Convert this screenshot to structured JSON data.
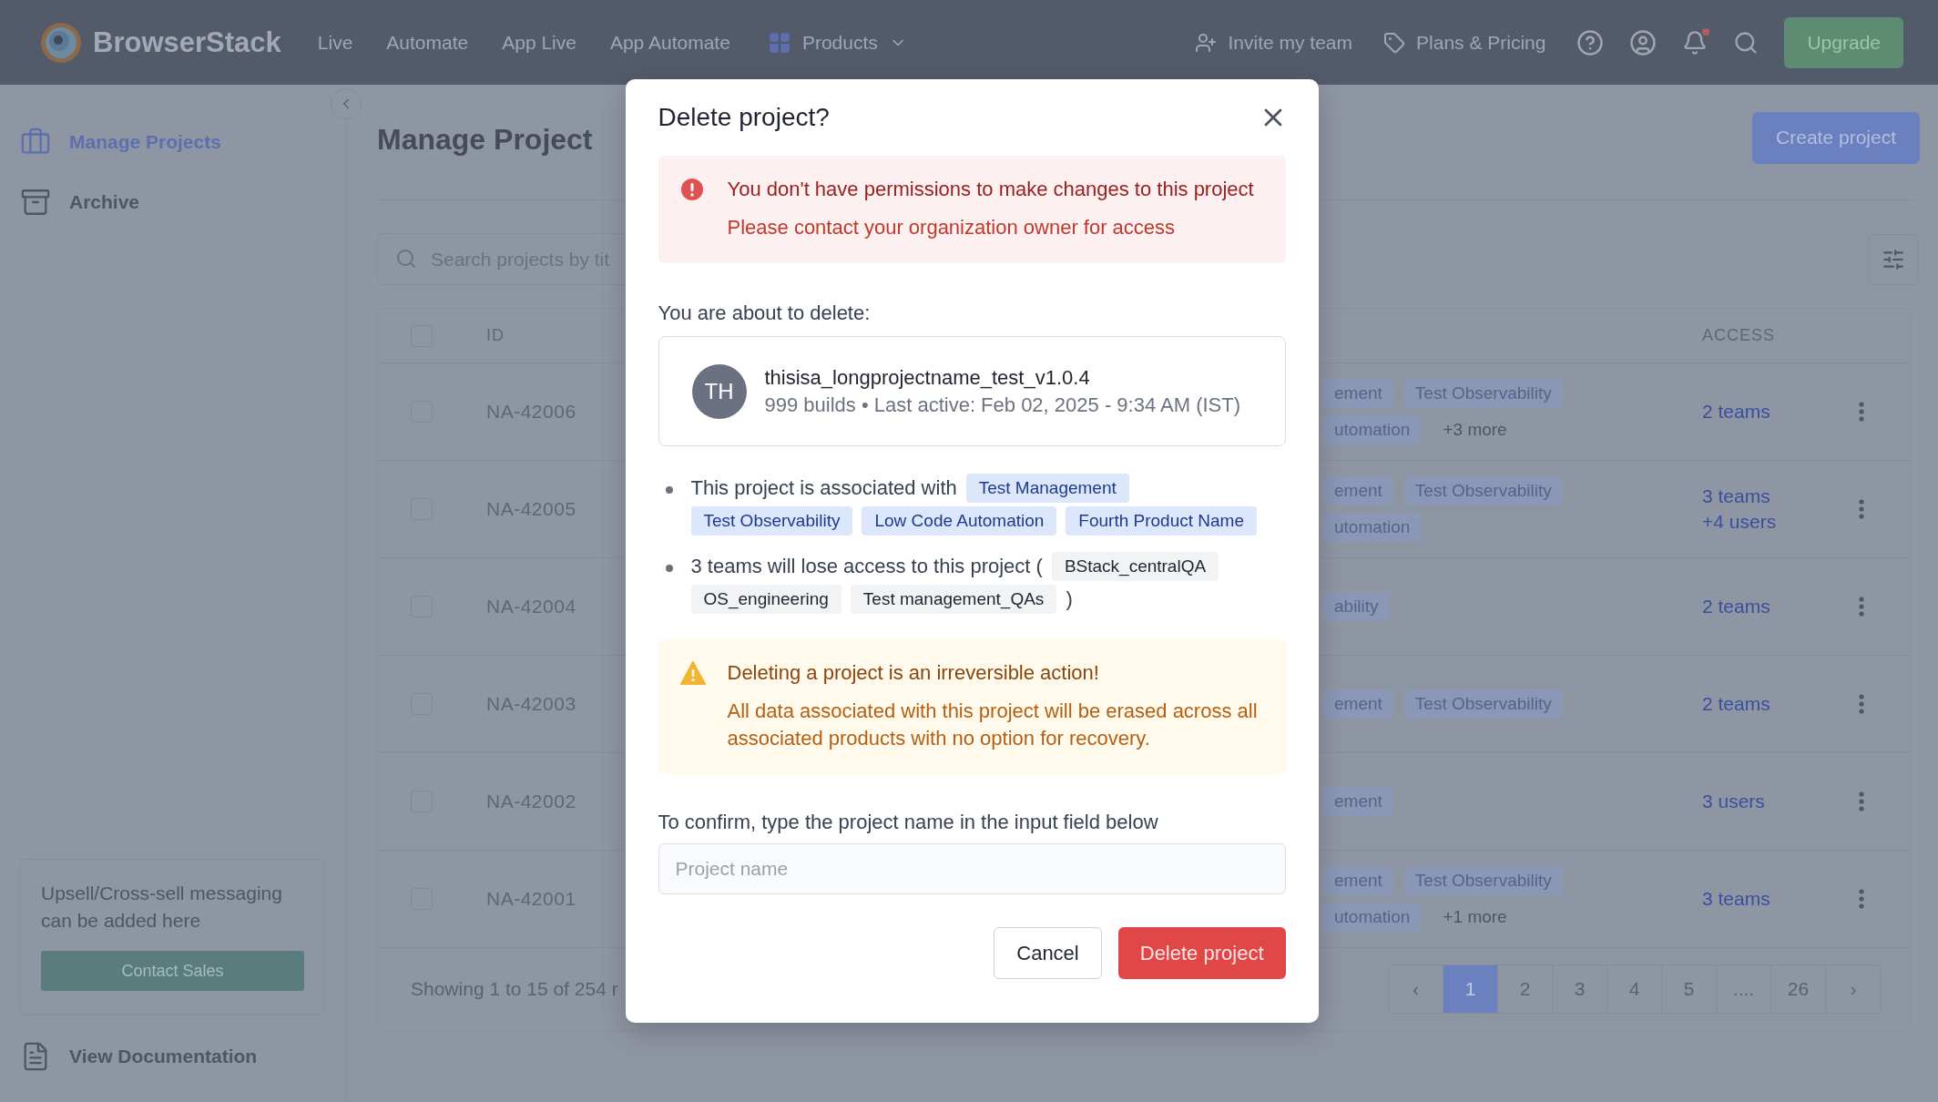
{
  "nav": {
    "logo": "BrowserStack",
    "links": [
      "Live",
      "Automate",
      "App Live",
      "App Automate"
    ],
    "products": "Products",
    "invite": "Invite my team",
    "pricing": "Plans & Pricing",
    "unread": true,
    "upgrade": "Upgrade"
  },
  "sidebar": {
    "items": [
      {
        "label": "Manage Projects",
        "selected": true
      },
      {
        "label": "Archive",
        "selected": false
      }
    ],
    "upsell": {
      "text": "Upsell/Cross-sell messaging can be added here",
      "button": "Contact Sales"
    },
    "docs": "View Documentation"
  },
  "page": {
    "title": "Manage Project",
    "create_button": "Create project",
    "search": {
      "placeholder": "Search projects by tit"
    }
  },
  "table": {
    "select_all": false,
    "columns": [
      "ID",
      "ACCESS"
    ],
    "rows": [
      {
        "id": "NA-42006",
        "checked": false,
        "tags": [
          [
            {
              "kind": "tag",
              "label": "ement"
            },
            {
              "kind": "tag",
              "label": "Test Observability"
            }
          ],
          [
            {
              "kind": "tag",
              "label": "utomation"
            },
            {
              "kind": "more",
              "label": "+3 more"
            }
          ]
        ],
        "access": [
          "2 teams"
        ]
      },
      {
        "id": "NA-42005",
        "checked": false,
        "tags": [
          [
            {
              "kind": "tag",
              "label": "ement"
            },
            {
              "kind": "tag",
              "label": "Test Observability"
            }
          ],
          [
            {
              "kind": "tag",
              "label": "utomation"
            }
          ]
        ],
        "access": [
          "3 teams",
          "+4 users"
        ]
      },
      {
        "id": "NA-42004",
        "checked": false,
        "tags": [
          [
            {
              "kind": "tag",
              "label": "ability"
            }
          ]
        ],
        "access": [
          "2 teams"
        ]
      },
      {
        "id": "NA-42003",
        "checked": false,
        "tags": [
          [
            {
              "kind": "tag",
              "label": "ement"
            },
            {
              "kind": "tag",
              "label": "Test Observability"
            }
          ]
        ],
        "access": [
          "2 teams"
        ]
      },
      {
        "id": "NA-42002",
        "checked": false,
        "tags": [
          [
            {
              "kind": "tag",
              "label": "ement"
            }
          ]
        ],
        "access": [
          "3 users"
        ]
      },
      {
        "id": "NA-42001",
        "checked": false,
        "tags": [
          [
            {
              "kind": "tag",
              "label": "ement"
            },
            {
              "kind": "tag",
              "label": "Test Observability"
            }
          ],
          [
            {
              "kind": "tag",
              "label": "utomation"
            },
            {
              "kind": "more",
              "label": "+1 more"
            }
          ]
        ],
        "access": [
          "3 teams"
        ]
      }
    ],
    "footer": "Showing 1 to 15 of 254 r"
  },
  "pagination": {
    "prev": "‹",
    "next": "›",
    "pages": [
      {
        "label": "1",
        "selected": true
      },
      {
        "label": "2",
        "selected": false
      },
      {
        "label": "3",
        "selected": false
      },
      {
        "label": "4",
        "selected": false
      },
      {
        "label": "5",
        "selected": false
      },
      {
        "label": "....",
        "selected": false
      },
      {
        "label": "26",
        "selected": false
      }
    ]
  },
  "dialog": {
    "title": "Delete project?",
    "error": {
      "title": "You don't have permissions to make changes to this project",
      "message": "Please contact your organization owner for access"
    },
    "intro": "You are about to delete:",
    "project": {
      "initials": "TH",
      "name": "thisisa_longprojectname_test_v1.0.4",
      "meta": "999 builds • Last active: Feb 02, 2025 - 9:34 AM (IST)"
    },
    "associations": {
      "text": "This project is associated with",
      "products": [
        "Test Management",
        "Test Observability",
        "Low Code Automation",
        "Fourth Product Name"
      ]
    },
    "teams": {
      "text": "3 teams will lose access to this project (",
      "teams": [
        "BStack_centralQA",
        "OS_engineering",
        "Test management_QAs"
      ],
      "closing": ")"
    },
    "warning": {
      "title": "Deleting a project is an irreversible action!",
      "message": "All data associated with this project will be erased across all associated products with no option for recovery."
    },
    "confirm": {
      "label": "To confirm, type the project name in the input field below",
      "placeholder": "Project name"
    },
    "buttons": [
      {
        "label": "Cancel",
        "kind": "secondary"
      },
      {
        "label": "Delete project",
        "kind": "danger"
      }
    ]
  }
}
